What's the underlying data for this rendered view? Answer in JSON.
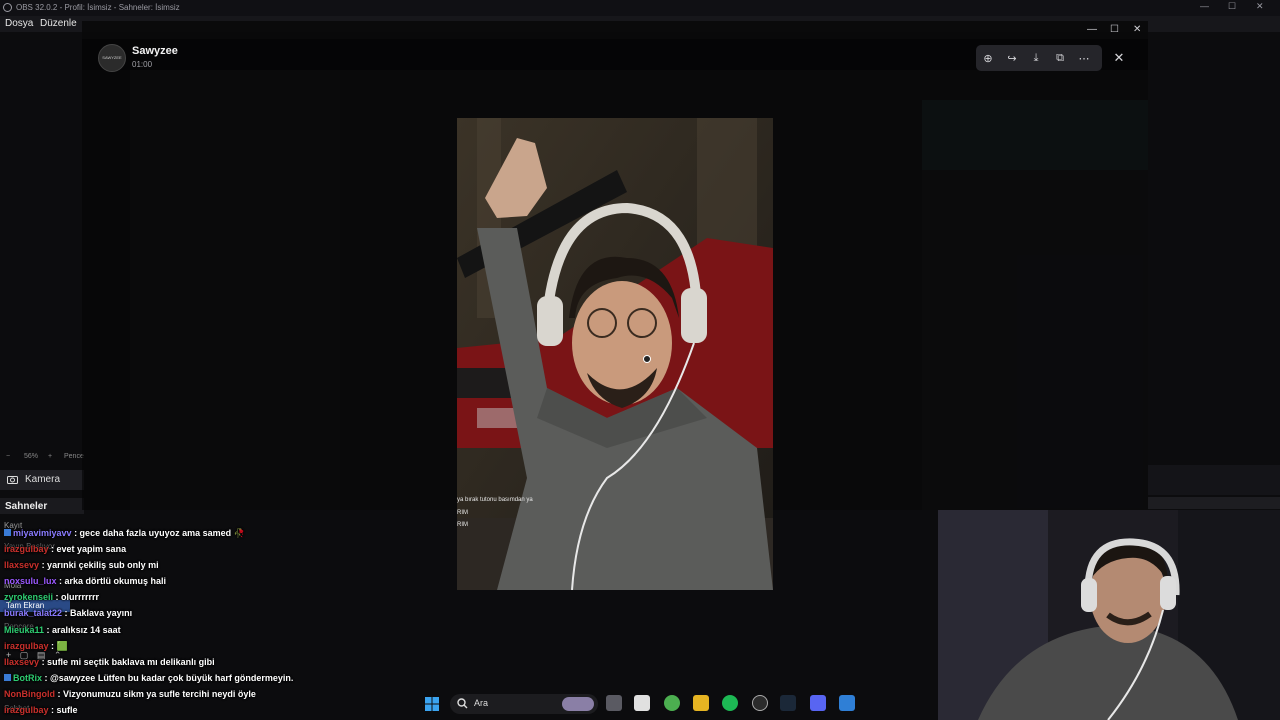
{
  "obs": {
    "window_title": "OBS 32.0.2 - Profil: İsimsiz - Sahneler: İsimsiz",
    "menu": [
      "Dosya",
      "Düzenle"
    ],
    "zoom": "56%",
    "zoom_minus": "−",
    "zoom_plus": "+",
    "zoom_extra": "Pence",
    "source": "Kamera",
    "scenes_header": "Sahneler",
    "scenes": [
      "Kayıt",
      "Yayın Başlıyor",
      "Mola",
      "Tam Ekran",
      "Pencere",
      "Sohbet"
    ]
  },
  "viewer": {
    "author_name": "Sawyzee",
    "author_time": "01:00",
    "avatar_text": "SAWYZEE",
    "tools": [
      "zoom-in",
      "forward",
      "download",
      "open-external",
      "more"
    ],
    "tool_glyphs": [
      "⊕",
      "↪",
      "⤓",
      "⧉",
      "⋯"
    ],
    "close_glyph": "✕",
    "photo_text": [
      "ya bırak tutonu basımdan ya",
      "RIM",
      "RIM"
    ]
  },
  "window_controls": [
    "—",
    "☐",
    "✕"
  ],
  "chat": [
    {
      "user": "miyavimiyavv",
      "color": "#8a7bff",
      "msg": ": gece daha fazla uyuyoz ama samed 🥀",
      "badge": "#3a7bd5"
    },
    {
      "user": "irazgulbay",
      "color": "#c9302c",
      "msg": ": evet yapim sana"
    },
    {
      "user": "llaxsevy",
      "color": "#c9302c",
      "msg": ": yarınki çekiliş sub only mi"
    },
    {
      "user": "noxsulu_lux",
      "color": "#9b59ff",
      "msg": ": arka dörtlü okumuş hali"
    },
    {
      "user": "zyrokenseii",
      "color": "#2ecc71",
      "msg": ": olurrrrrrr"
    },
    {
      "user": "burak_talat22",
      "color": "#8a7bff",
      "msg": ": Baklava yayını"
    },
    {
      "user": "Mieuka11",
      "color": "#2ecc71",
      "msg": ": aralıksız 14 saat"
    },
    {
      "user": "irazgulbay",
      "color": "#c9302c",
      "msg": ": 🟩"
    },
    {
      "user": "llaxsevy",
      "color": "#c9302c",
      "msg": ": sufle mi seçtik baklava mı delikanlı gibi"
    },
    {
      "user": "BotRix",
      "color": "#2ecc71",
      "msg": ": @sawyzee Lütfen bu kadar çok büyük harf göndermeyin.",
      "badge": "#3a7bd5"
    },
    {
      "user": "NonBingold",
      "color": "#c9302c",
      "msg": ": Vizyonumuzu sikm ya sufle tercihi neydi öyle"
    },
    {
      "user": "irazgulbay",
      "color": "#c9302c",
      "msg": ": sufle"
    }
  ],
  "taskbar": {
    "search_label": "Ara"
  }
}
